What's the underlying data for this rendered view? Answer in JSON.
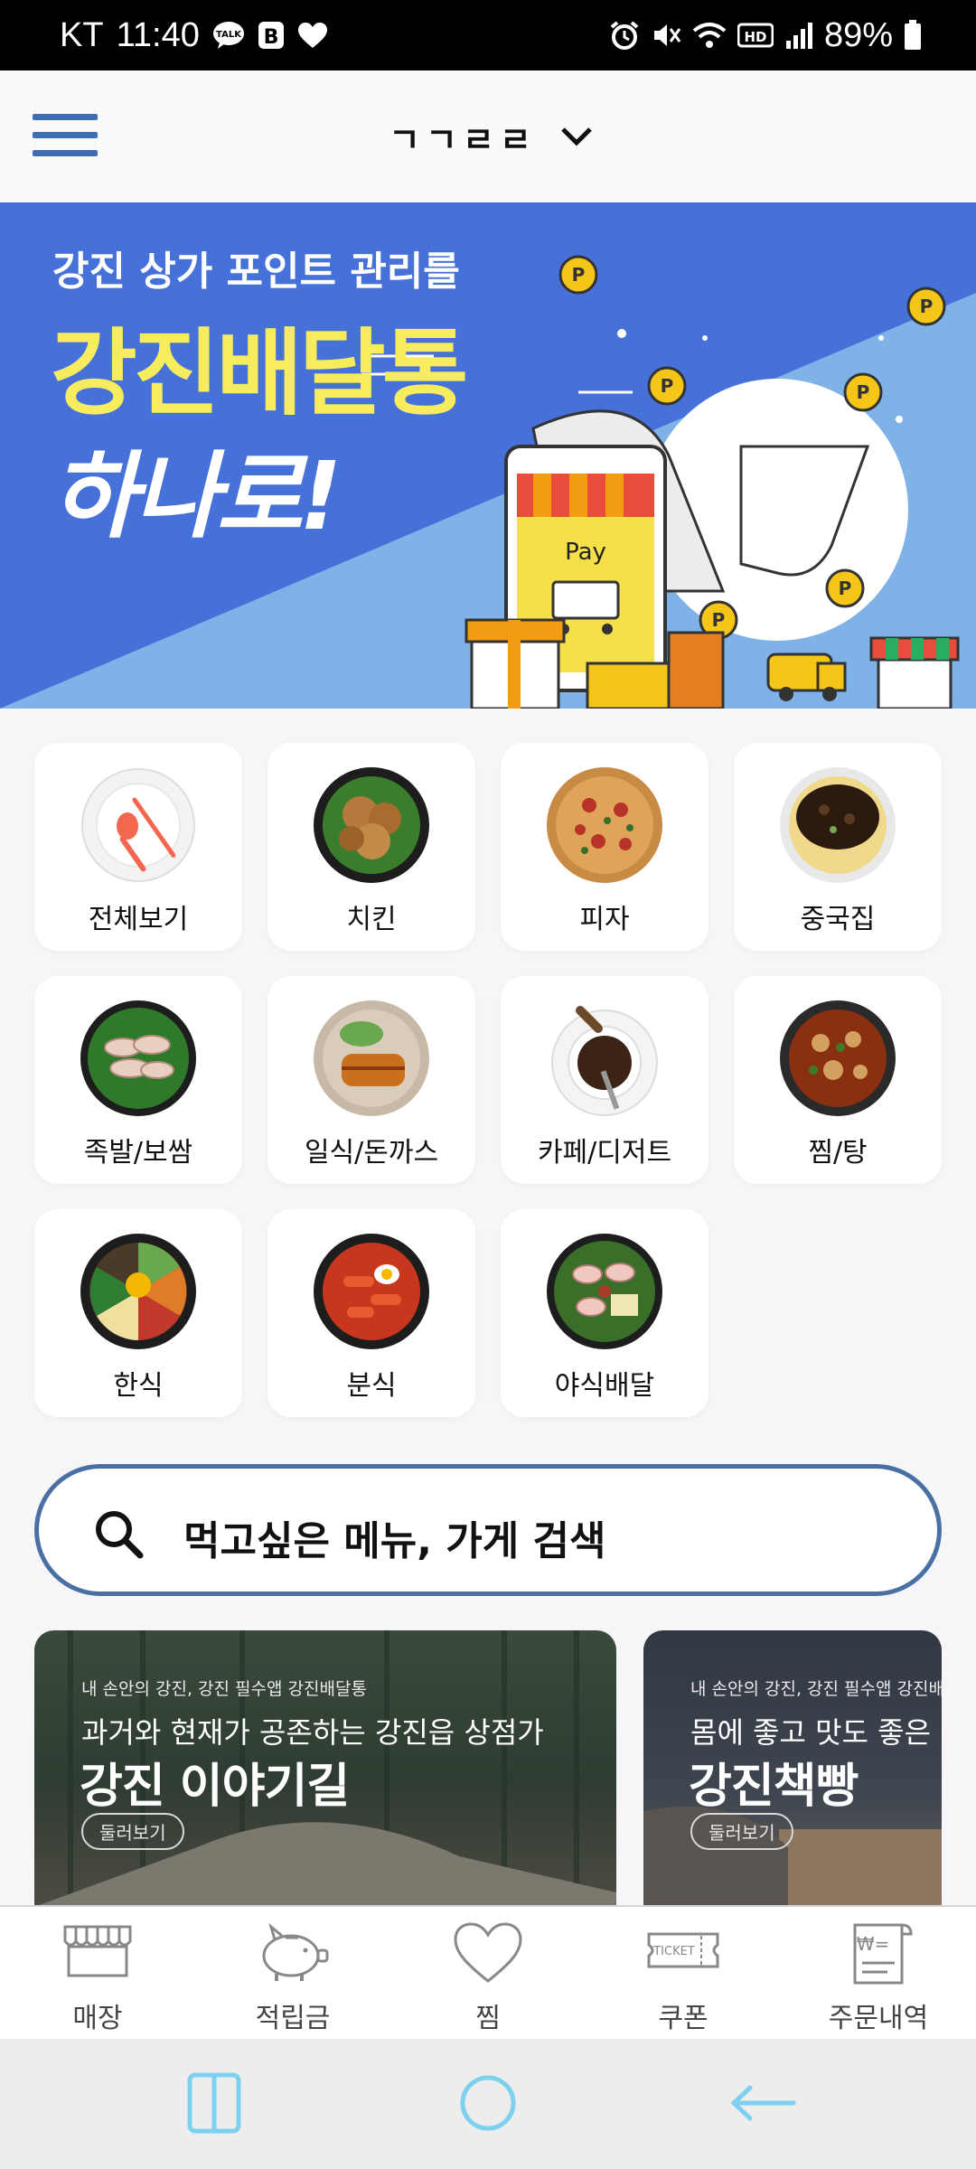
{
  "status_bar": {
    "carrier": "KT",
    "time": "11:40",
    "battery": "89%",
    "left_icons": [
      "talk-icon",
      "b-icon",
      "heart-icon"
    ],
    "right_icons": [
      "alarm-icon",
      "mute-icon",
      "wifi-icon",
      "hd-icon",
      "signal-icon",
      "battery-icon"
    ]
  },
  "header": {
    "title": "ㄱㄱㄹㄹ",
    "menu_icon": "hamburger-icon",
    "dropdown_icon": "chevron-down-icon"
  },
  "banner": {
    "line1": "강진 상가 포인트 관리를",
    "line2": "강진배달통",
    "line3": "하나로!",
    "phone_label": "Pay"
  },
  "categories": [
    {
      "label": "전체보기"
    },
    {
      "label": "치킨"
    },
    {
      "label": "피자"
    },
    {
      "label": "중국집"
    },
    {
      "label": "족발/보쌈"
    },
    {
      "label": "일식/돈까스"
    },
    {
      "label": "카페/디저트"
    },
    {
      "label": "찜/탕"
    },
    {
      "label": "한식"
    },
    {
      "label": "분식"
    },
    {
      "label": "야식배달"
    }
  ],
  "search": {
    "placeholder": "먹고싶은 메뉴, 가게 검색"
  },
  "promos": [
    {
      "small": "내 손안의 강진, 강진 필수앱 강진배달통",
      "sub": "과거와 현재가 공존하는 강진읍 상점가",
      "big": "강진 이야기길",
      "button": "둘러보기"
    },
    {
      "small": "내 손안의 강진, 강진 필수앱 강진배",
      "sub": "몸에 좋고 맛도 좋은 강진",
      "big": "강진책빵",
      "button": "둘러보기"
    }
  ],
  "bottom_nav": [
    {
      "label": "매장",
      "icon": "store-icon"
    },
    {
      "label": "적립금",
      "icon": "piggy-bank-icon"
    },
    {
      "label": "찜",
      "icon": "heart-icon"
    },
    {
      "label": "쿠폰",
      "icon": "ticket-icon",
      "icon_text": "TICKET"
    },
    {
      "label": "주문내역",
      "icon": "receipt-icon",
      "icon_text": "₩="
    }
  ],
  "system_nav": [
    "recents-icon",
    "home-icon",
    "back-icon"
  ],
  "colors": {
    "accent": "#3f6eb4",
    "banner_blue": "#4671d9",
    "banner_yellow": "#f7ec5e",
    "search_border": "#4a6fa5"
  }
}
